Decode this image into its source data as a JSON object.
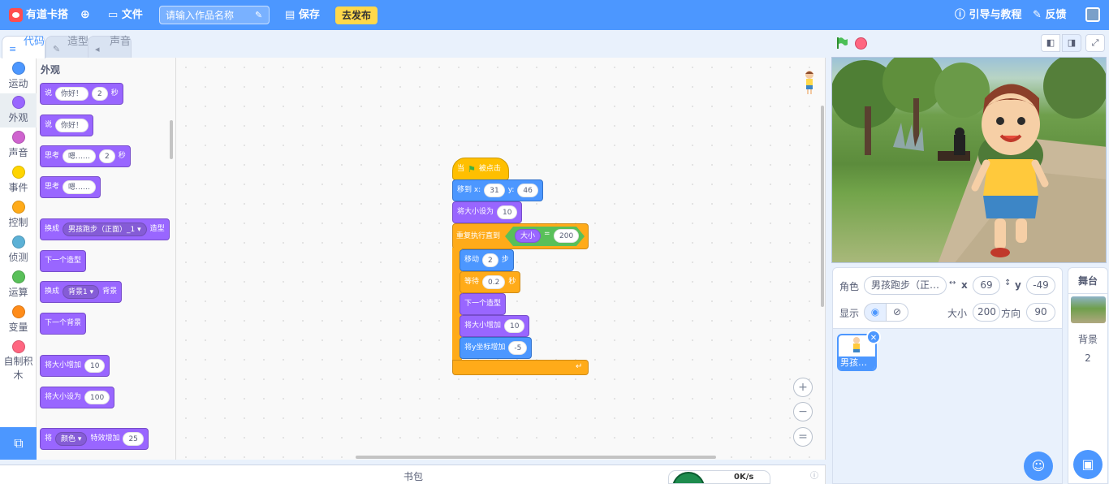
{
  "topbar": {
    "logo_text": "有道卡搭",
    "file_menu": "文件",
    "title_placeholder": "请输入作品名称",
    "save": "保存",
    "publish": "去发布",
    "guide": "引导与教程",
    "feedback": "反馈"
  },
  "tabs": [
    {
      "label": "代码"
    },
    {
      "label": "造型"
    },
    {
      "label": "声音"
    }
  ],
  "categories": [
    {
      "label": "运动",
      "color": "#4c97ff"
    },
    {
      "label": "外观",
      "color": "#9966ff"
    },
    {
      "label": "声音",
      "color": "#cf63cf"
    },
    {
      "label": "事件",
      "color": "#ffd500"
    },
    {
      "label": "控制",
      "color": "#ffab19"
    },
    {
      "label": "侦测",
      "color": "#5cb1d6"
    },
    {
      "label": "运算",
      "color": "#59c059"
    },
    {
      "label": "变量",
      "color": "#ff8c1a"
    },
    {
      "label": "自制积木",
      "color": "#ff6680"
    }
  ],
  "palette": {
    "title": "外观",
    "b1": {
      "say": "说",
      "hello": "你好！",
      "secs": "2",
      "unit": "秒"
    },
    "b2": {
      "say": "说",
      "hello": "你好！"
    },
    "b3": {
      "think": "思考",
      "hmm": "嗯……",
      "secs": "2",
      "unit": "秒"
    },
    "b4": {
      "think": "思考",
      "hmm": "嗯……"
    },
    "b5": {
      "switch": "换成",
      "costume": "男孩跑步（正面）_1",
      "suffix": "造型"
    },
    "b6": {
      "label": "下一个造型"
    },
    "b7": {
      "switch": "换成",
      "backdrop": "背景1",
      "suffix": "背景"
    },
    "b8": {
      "label": "下一个背景"
    },
    "b9": {
      "label": "将大小增加",
      "value": "10"
    },
    "b10": {
      "label": "将大小设为",
      "value": "100"
    },
    "b11": {
      "prefix": "将",
      "effect": "颜色",
      "mid": "特效增加",
      "value": "25"
    }
  },
  "script": {
    "hat": {
      "when": "当",
      "clicked": "被点击"
    },
    "goto": {
      "label": "移到 x:",
      "x": "31",
      "ylabel": "y:",
      "y": "46"
    },
    "setsize": {
      "label": "将大小设为",
      "value": "10"
    },
    "repeat": {
      "label": "重复执行直到",
      "cond_label": "大小",
      "eq": "=",
      "cond_value": "200"
    },
    "move": {
      "label": "移动",
      "value": "2",
      "unit": "步"
    },
    "wait": {
      "label": "等待",
      "value": "0.2",
      "unit": "秒"
    },
    "next": {
      "label": "下一个造型"
    },
    "changesize": {
      "label": "将大小增加",
      "value": "10"
    },
    "changey": {
      "label": "将y坐标增加",
      "value": "-5"
    }
  },
  "zoom": {
    "in": "+",
    "out": "−",
    "reset": "="
  },
  "backpack": {
    "label": "书包"
  },
  "speed": {
    "text": "0K/s"
  },
  "sprite": {
    "label_sprite": "角色",
    "name": "男孩跑步（正…",
    "x_label": "x",
    "x": "69",
    "y_label": "y",
    "y": "-49",
    "show_label": "显示",
    "size_label": "大小",
    "size": "200",
    "dir_label": "方向",
    "dir": "90"
  },
  "sprite_list": {
    "thumb_name": "男孩…"
  },
  "stage_panel": {
    "title": "舞台",
    "backdrop_label": "背景",
    "backdrop_count": "2"
  }
}
